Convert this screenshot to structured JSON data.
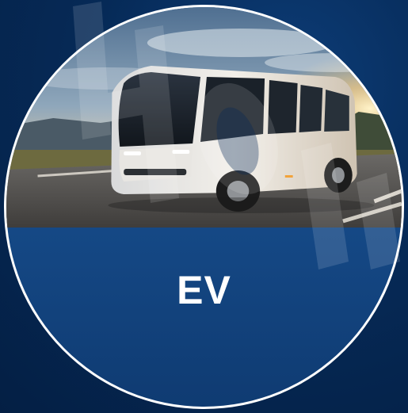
{
  "badge": {
    "label": "EV",
    "image_subject": "electric-bus-photo",
    "colors": {
      "background": "#062a57",
      "badge_fill": "#174d8c",
      "ring": "#ffffff",
      "label": "#ffffff"
    }
  }
}
